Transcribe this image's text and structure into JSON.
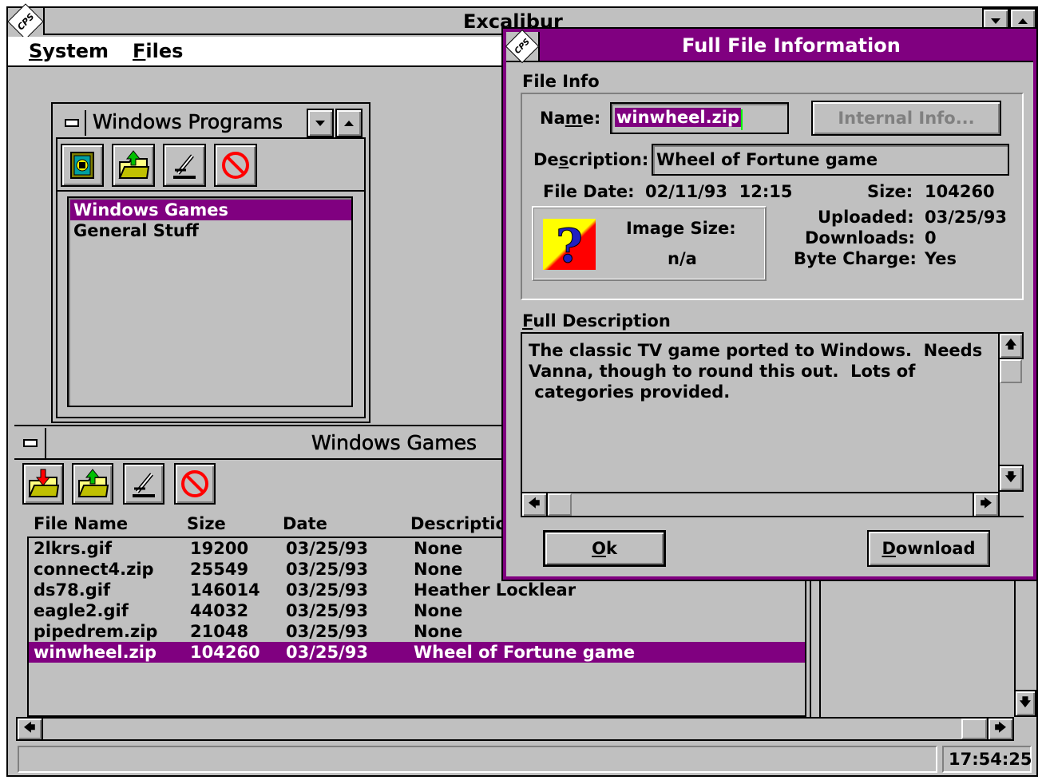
{
  "colors": {
    "accent": "#800080",
    "face": "#c0c0c0",
    "shadow": "#808080"
  },
  "main": {
    "title": "Excalibur",
    "menu": [
      "System",
      "Files"
    ],
    "clock": "17:54:25"
  },
  "programs_window": {
    "title": "Windows Programs",
    "toolbar_icons": [
      "book-icon",
      "open-folder-icon",
      "microscope-icon",
      "cancel-icon"
    ],
    "items": [
      "Windows Games",
      "General Stuff"
    ],
    "selected": "Windows Games"
  },
  "games_window": {
    "title": "Windows Games",
    "toolbar_icons": [
      "download-folder-icon",
      "open-folder-icon",
      "microscope-icon",
      "cancel-icon"
    ],
    "columns": [
      "File Name",
      "Size",
      "Date",
      "Descriptio"
    ],
    "rows": [
      [
        "2lkrs.gif",
        "19200",
        "03/25/93",
        "None"
      ],
      [
        "connect4.zip",
        "25549",
        "03/25/93",
        "None"
      ],
      [
        "ds78.gif",
        "146014",
        "03/25/93",
        "Heather Locklear"
      ],
      [
        "eagle2.gif",
        "44032",
        "03/25/93",
        "None"
      ],
      [
        "pipedrem.zip",
        "21048",
        "03/25/93",
        "None"
      ],
      [
        "winwheel.zip",
        "104260",
        "03/25/93",
        "Wheel of Fortune game"
      ]
    ],
    "selected_row": "winwheel.zip"
  },
  "dialog": {
    "title": "Full File Information",
    "file_info_label": "File Info",
    "name_label": "Name:",
    "name_value": "winwheel.zip",
    "internal_info_button": "Internal Info...",
    "description_label": "Description:",
    "description_value": "Wheel of Fortune game",
    "file_date_label": "File Date:",
    "file_date_value": "02/11/93  12:15",
    "size_label": "Size:",
    "size_value": "104260",
    "image_size_label": "Image Size:",
    "image_size_value": "n/a",
    "uploaded_label": "Uploaded:",
    "uploaded_value": "03/25/93",
    "downloads_label": "Downloads:",
    "downloads_value": "0",
    "byte_charge_label": "Byte Charge:",
    "byte_charge_value": "Yes",
    "full_description_label": "Full Description",
    "full_description_lines": [
      "The classic TV game ported to Windows.  Needs",
      "Vanna, though to round this out.  Lots of",
      " categories provided."
    ],
    "ok_button": "Ok",
    "download_button": "Download"
  }
}
